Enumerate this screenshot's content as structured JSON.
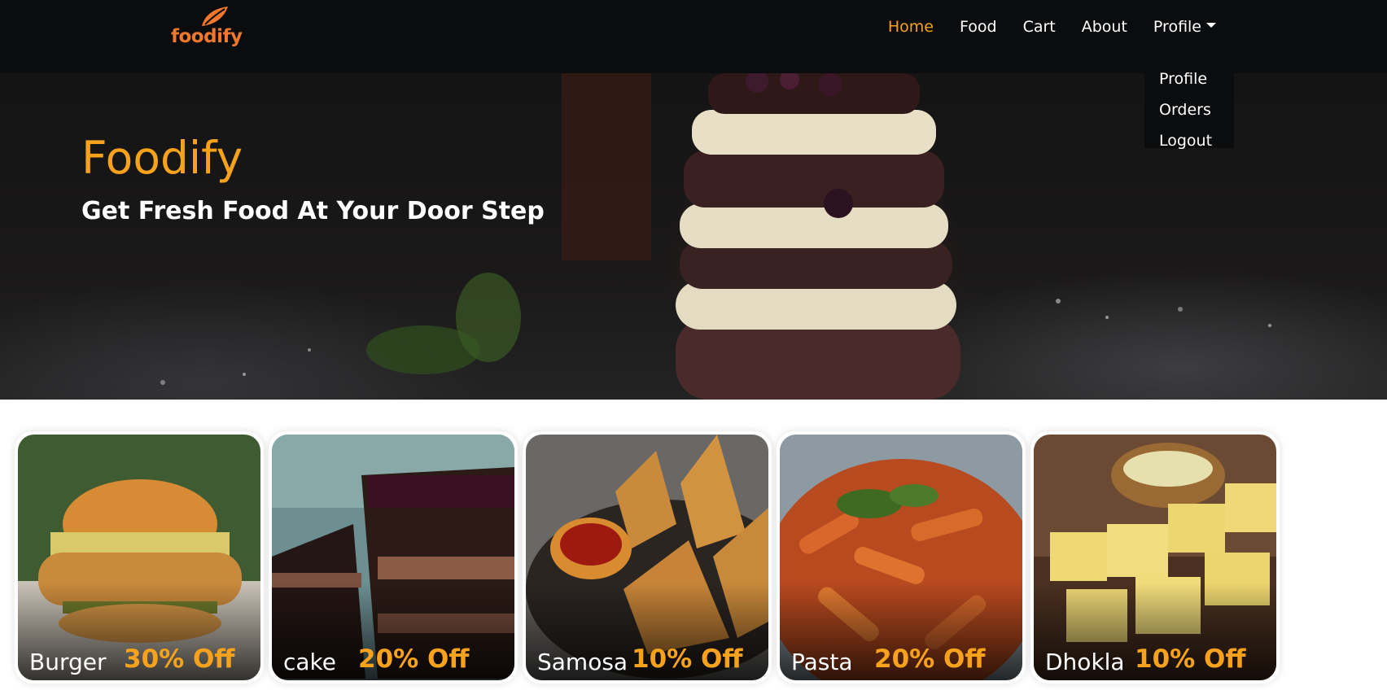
{
  "brand": {
    "logo_text": "foodify",
    "logo_color": "#f0772c",
    "accent_color": "#f7a21d"
  },
  "nav": {
    "items": [
      {
        "label": "Home",
        "active": true
      },
      {
        "label": "Food",
        "active": false
      },
      {
        "label": "Cart",
        "active": false
      },
      {
        "label": "About",
        "active": false
      },
      {
        "label": "Profile",
        "active": false,
        "has_dropdown": true
      }
    ]
  },
  "profile_dropdown": {
    "items": [
      "Profile",
      "Orders",
      "Logout"
    ]
  },
  "hero": {
    "title": "Foodify",
    "subtitle": "Get Fresh Food At Your Door Step"
  },
  "cards": [
    {
      "name": "Burger",
      "offer": "30% Off",
      "icon": "burger-image"
    },
    {
      "name": "cake",
      "offer": "20% Off",
      "icon": "cake-image"
    },
    {
      "name": "Samosa",
      "offer": "10% Off",
      "icon": "samosa-image"
    },
    {
      "name": "Pasta",
      "offer": "20% Off",
      "icon": "pasta-image"
    },
    {
      "name": "Dhokla",
      "offer": "10% Off",
      "icon": "dhokla-image"
    }
  ]
}
